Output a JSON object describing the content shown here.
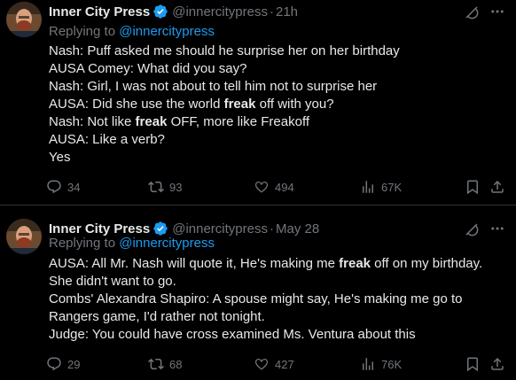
{
  "tweets": [
    {
      "name": "Inner City Press",
      "handle": "@innercitypress",
      "dot": "·",
      "time": "21h",
      "replying_prefix": "Replying to",
      "replying_to": "@innercitypress",
      "lines": [
        [
          {
            "t": "Nash: Puff asked me should he surprise her on her birthday"
          }
        ],
        [
          {
            "t": "AUSA Comey: What did you say?"
          }
        ],
        [
          {
            "t": "Nash: Girl, I was not about to tell him not to surprise her"
          }
        ],
        [
          {
            "t": "AUSA: Did she use the world "
          },
          {
            "t": "freak",
            "b": true
          },
          {
            "t": " off with you?"
          }
        ],
        [
          {
            "t": "Nash: Not like "
          },
          {
            "t": "freak",
            "b": true
          },
          {
            "t": " OFF, more like Freakoff"
          }
        ],
        [
          {
            "t": "AUSA: Like a verb?"
          }
        ],
        [
          {
            "t": "Yes"
          }
        ]
      ],
      "replies": "34",
      "reposts": "93",
      "likes": "494",
      "views": "67K"
    },
    {
      "name": "Inner City Press",
      "handle": "@innercitypress",
      "dot": "·",
      "time": "May 28",
      "replying_prefix": "Replying to",
      "replying_to": "@innercitypress",
      "lines": [
        [
          {
            "t": "AUSA: All Mr. Nash will quote it, He's making me "
          },
          {
            "t": "freak",
            "b": true
          },
          {
            "t": " off on my birthday."
          }
        ],
        [
          {
            "t": "She didn't want to go."
          }
        ],
        [
          {
            "t": "Combs' Alexandra Shapiro: A spouse might say, He's making me go to"
          }
        ],
        [
          {
            "t": "Rangers game, I'd rather not tonight."
          }
        ],
        [
          {
            "t": "Judge: You could have cross examined Ms. Ventura about this"
          }
        ]
      ],
      "replies": "29",
      "reposts": "68",
      "likes": "427",
      "views": "76K"
    }
  ],
  "colors": {
    "background": "#000000",
    "text": "#e7e9ea",
    "muted": "#71767b",
    "accent": "#1d9bf0",
    "verified": "#1d9bf0",
    "divider": "#2f3336"
  },
  "icons": [
    "verified-badge-icon",
    "grok-icon",
    "more-icon",
    "reply-icon",
    "repost-icon",
    "like-icon",
    "views-icon",
    "bookmark-icon",
    "share-icon"
  ]
}
